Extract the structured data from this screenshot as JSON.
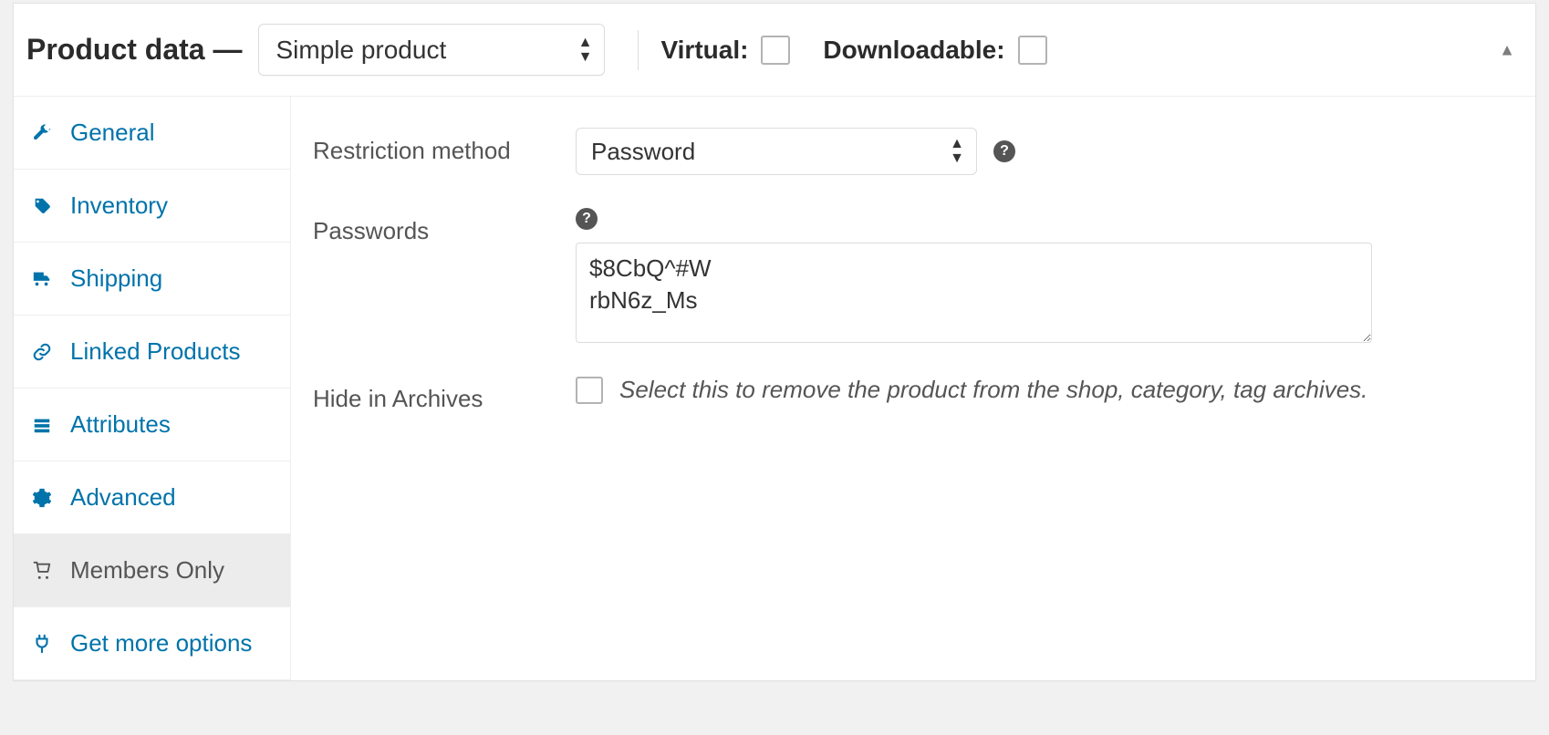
{
  "header": {
    "title": "Product data —",
    "product_type": "Simple product",
    "virtual_label": "Virtual:",
    "downloadable_label": "Downloadable:"
  },
  "tabs": [
    {
      "id": "general",
      "label": "General"
    },
    {
      "id": "inventory",
      "label": "Inventory"
    },
    {
      "id": "shipping",
      "label": "Shipping"
    },
    {
      "id": "linked",
      "label": "Linked Products"
    },
    {
      "id": "attributes",
      "label": "Attributes"
    },
    {
      "id": "advanced",
      "label": "Advanced"
    },
    {
      "id": "members",
      "label": "Members Only"
    },
    {
      "id": "more",
      "label": "Get more options"
    }
  ],
  "active_tab": "members",
  "fields": {
    "restriction_method": {
      "label": "Restriction method",
      "value": "Password"
    },
    "passwords": {
      "label": "Passwords",
      "value": "$8CbQ^#W\nrbN6z_Ms"
    },
    "hide_in_archives": {
      "label": "Hide in Archives",
      "description": "Select this to remove the product from the shop, category, tag archives."
    }
  }
}
